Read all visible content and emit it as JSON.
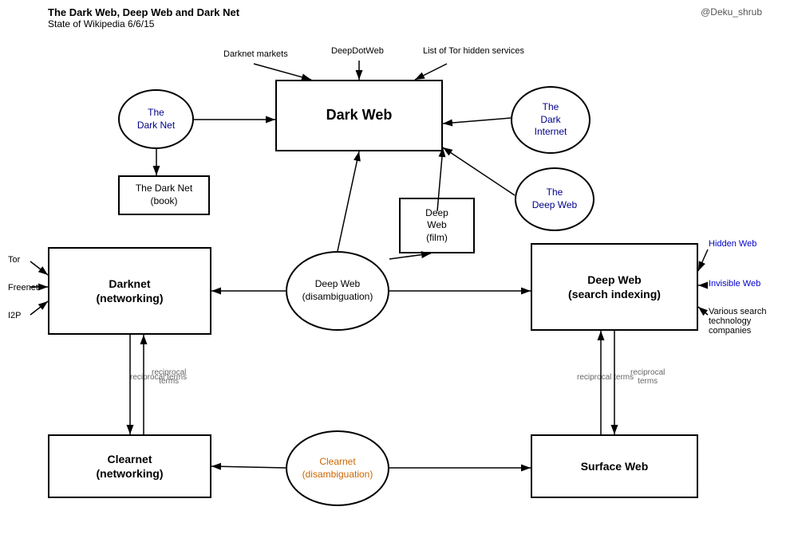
{
  "title": {
    "main": "The Dark Web, Deep Web and Dark Net",
    "sub": "State of Wikipedia 6/6/15",
    "credit": "@Deku_shrub"
  },
  "nodes": {
    "dark_web": {
      "label": "Dark Web",
      "type": "rect-large"
    },
    "dark_net_circle": {
      "label": "The\nDark Net",
      "type": "circle-blue"
    },
    "dark_net_book": {
      "label": "The Dark Net\n(book)",
      "type": "rect"
    },
    "dark_internet": {
      "label": "The\nDark\nInternet",
      "type": "circle-blue"
    },
    "deep_web_circle_top": {
      "label": "The\nDeep Web",
      "type": "circle-blue"
    },
    "deep_web_film": {
      "label": "Deep\nWeb\n(film)",
      "type": "rect"
    },
    "deep_web_disambiguation": {
      "label": "Deep Web\n(disambiguation)",
      "type": "circle"
    },
    "darknet_networking": {
      "label": "Darknet\n(networking)",
      "type": "rect-large"
    },
    "deep_web_search": {
      "label": "Deep Web\n(search indexing)",
      "type": "rect-large"
    },
    "clearnet_disambiguation": {
      "label": "Clearnet\n(disambiguation)",
      "type": "circle-orange"
    },
    "clearnet_networking": {
      "label": "Clearnet\n(networking)",
      "type": "rect-large"
    },
    "surface_web": {
      "label": "Surface Web",
      "type": "rect-large"
    }
  },
  "side_labels": {
    "tor": "Tor",
    "freenet": "Freenet",
    "i2p": "I2P",
    "hidden_web": "Hidden Web",
    "invisible_web": "Invisible Web",
    "various_search": "Various search\ntechnology\ncompanies"
  },
  "top_labels": {
    "darknet_markets": "Darknet markets",
    "deepdotweb": "DeepDotWeb",
    "list_tor": "List of Tor\nhidden services"
  },
  "arrow_labels": {
    "reciprocal1": "reciprocal\nterms",
    "reciprocal2": "reciprocal\nterms"
  }
}
